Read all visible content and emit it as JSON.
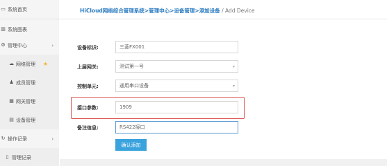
{
  "sidebar": {
    "items": [
      {
        "label": "系统首页",
        "icon": "home-icon",
        "glyph": "▭",
        "chevron": "",
        "star": ""
      },
      {
        "label": "系统图表",
        "icon": "bar-chart-icon",
        "glyph": "▥",
        "chevron": "",
        "star": ""
      },
      {
        "label": "管理中心",
        "icon": "gears-icon",
        "glyph": "⚙",
        "chevron": "›",
        "star": ""
      },
      {
        "label": "网络管理",
        "icon": "cloud-icon",
        "glyph": "☁",
        "chevron": "",
        "star": "★"
      },
      {
        "label": "成员管理",
        "icon": "users-icon",
        "glyph": "♟",
        "chevron": "",
        "star": ""
      },
      {
        "label": "网关管理",
        "icon": "grid-icon",
        "glyph": "▦",
        "chevron": "",
        "star": ""
      },
      {
        "label": "设备管理",
        "icon": "device-icon",
        "glyph": "▤",
        "chevron": "",
        "star": ""
      },
      {
        "label": "操作记录",
        "icon": "history-icon",
        "glyph": "↻",
        "chevron": "›",
        "star": ""
      },
      {
        "label": "管理记录",
        "icon": "document-icon",
        "glyph": "▯",
        "chevron": "",
        "star": ""
      }
    ]
  },
  "breadcrumb": {
    "items": [
      "HiCloud网络综合管理系统",
      "管理中心",
      "设备管理",
      "添加设备"
    ],
    "separator": ">",
    "current": " / Add Device"
  },
  "form": {
    "device_id": {
      "label": "设备标识:",
      "value": "三菱FX001"
    },
    "gateway": {
      "label": "上层网关:",
      "value": "测试第一号"
    },
    "control_unit": {
      "label": "控制单元:",
      "value": "通用串口设备"
    },
    "port_params": {
      "label": "接口参数:",
      "value": "1909"
    },
    "remarks": {
      "label": "备注信息:",
      "value": "RS422接口"
    },
    "submit_label": "确认添加"
  },
  "colors": {
    "accent": "#3aa3dd",
    "link": "#2a7bc0",
    "highlight": "#d9534f",
    "star": "#f2b632"
  }
}
